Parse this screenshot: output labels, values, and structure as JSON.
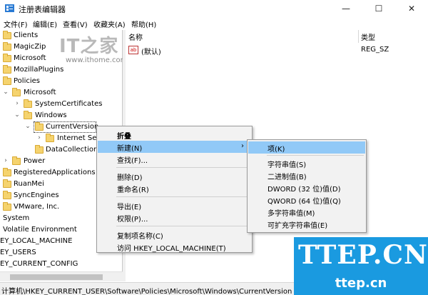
{
  "window": {
    "title": "注册表编辑器",
    "minimize_glyph": "—",
    "maximize_glyph": "☐",
    "close_glyph": "✕",
    "icon": "regedit-icon"
  },
  "menubar": {
    "items": [
      "文件(F)",
      "编辑(E)",
      "查看(V)",
      "收藏夹(A)",
      "帮助(H)"
    ]
  },
  "tree": {
    "items": [
      {
        "label": "Clients",
        "chev": ""
      },
      {
        "label": "MagicZip",
        "chev": ""
      },
      {
        "label": "Microsoft",
        "chev": ""
      },
      {
        "label": "MozillaPlugins",
        "chev": ""
      },
      {
        "label": "Policies",
        "chev": ""
      },
      {
        "label": "Microsoft",
        "chev": "⌄"
      },
      {
        "label": "SystemCertificates",
        "chev": "›"
      },
      {
        "label": "Windows",
        "chev": "⌄"
      },
      {
        "label": "CurrentVersion",
        "chev": "⌄"
      },
      {
        "label": "Internet Settings",
        "chev": "›"
      },
      {
        "label": "DataCollection",
        "chev": ""
      },
      {
        "label": "Power",
        "chev": "›"
      },
      {
        "label": "RegisteredApplications",
        "chev": ""
      },
      {
        "label": "RuanMei",
        "chev": ""
      },
      {
        "label": "SyncEngines",
        "chev": ""
      },
      {
        "label": "VMware, Inc.",
        "chev": ""
      },
      {
        "label": "System",
        "chev": ""
      },
      {
        "label": "Volatile Environment",
        "chev": ""
      },
      {
        "label": "EY_LOCAL_MACHINE",
        "chev": ""
      },
      {
        "label": "EY_USERS",
        "chev": ""
      },
      {
        "label": "EY_CURRENT_CONFIG",
        "chev": ""
      }
    ]
  },
  "watermark": {
    "logo": "IT之家",
    "url": "www.ithome.com"
  },
  "values_pane": {
    "col_name": "名称",
    "col_type": "类型",
    "rows": [
      {
        "icon": "ab",
        "name": "(默认)",
        "type": "REG_SZ"
      }
    ]
  },
  "context_menu": {
    "items": [
      {
        "label": "折叠",
        "bold": true
      },
      {
        "label": "新建(N)",
        "arrow": "›",
        "hover": true
      },
      {
        "label": "查找(F)..."
      },
      {
        "label": "删除(D)"
      },
      {
        "label": "重命名(R)"
      },
      {
        "label": "导出(E)"
      },
      {
        "label": "权限(P)..."
      },
      {
        "label": "复制项名称(C)"
      },
      {
        "label": "访问 HKEY_LOCAL_MACHINE(T)"
      }
    ]
  },
  "submenu": {
    "items": [
      {
        "label": "项(K)",
        "hover": true
      },
      {
        "label": "字符串值(S)"
      },
      {
        "label": "二进制值(B)"
      },
      {
        "label": "DWORD (32 位)值(D)"
      },
      {
        "label": "QWORD (64 位)值(Q)"
      },
      {
        "label": "多字符串值(M)"
      },
      {
        "label": "可扩充字符串值(E)"
      }
    ]
  },
  "statusbar": {
    "path": "计算机\\HKEY_CURRENT_USER\\Software\\Policies\\Microsoft\\Windows\\CurrentVersion"
  },
  "site_watermark": {
    "big": "TTEP.CN",
    "small": "ttep.cn"
  },
  "colors": {
    "hover": "#91c9f7",
    "folder": "#f5d36e",
    "watermark_bg": "#1a9ae0"
  }
}
